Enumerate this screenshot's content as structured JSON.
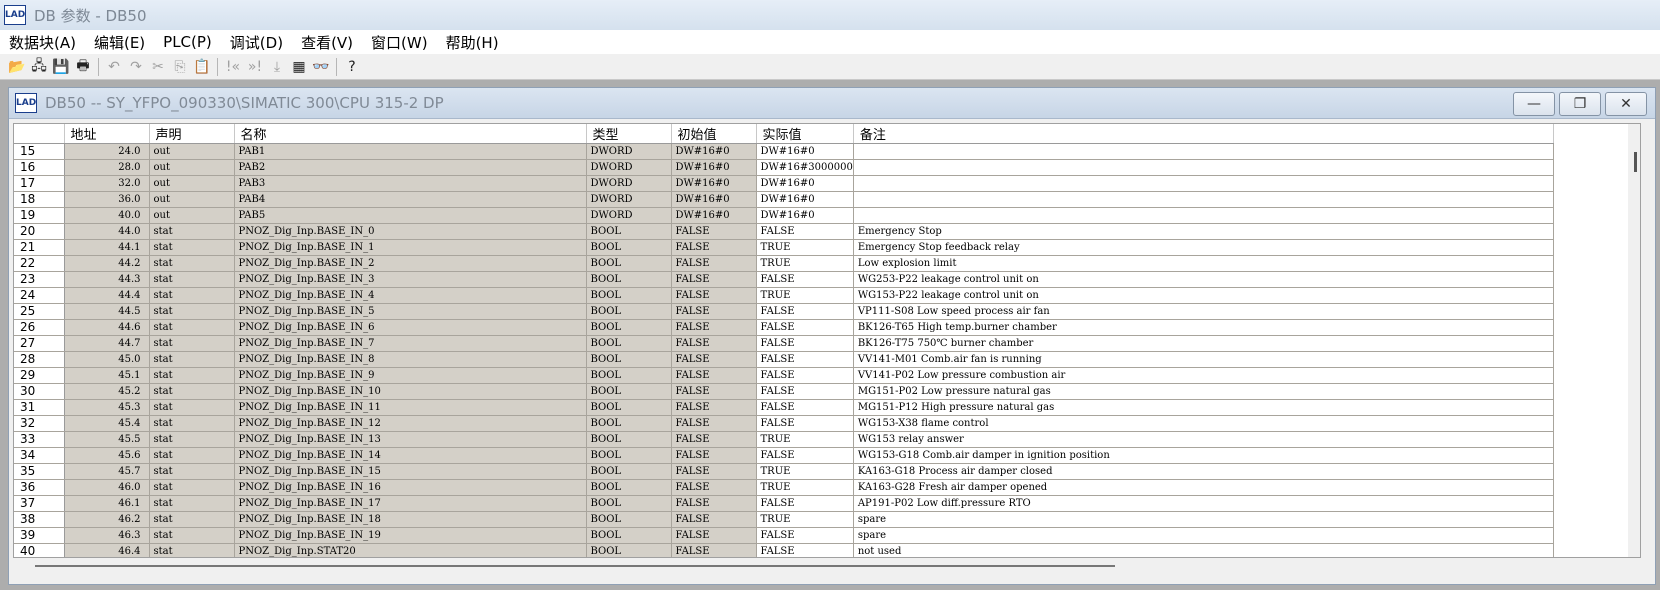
{
  "app": {
    "title": "DB 参数 - DB50",
    "icon_label": "LAD"
  },
  "menu": [
    "数据块(A)",
    "编辑(E)",
    "PLC(P)",
    "调试(D)",
    "查看(V)",
    "窗口(W)",
    "帮助(H)"
  ],
  "toolbar": [
    {
      "name": "open-icon",
      "glyph": "📂",
      "enabled": true
    },
    {
      "name": "network-icon",
      "glyph": "🖧",
      "enabled": true
    },
    {
      "name": "save-icon",
      "glyph": "💾",
      "enabled": true
    },
    {
      "name": "print-icon",
      "glyph": "🖶",
      "enabled": true
    },
    {
      "sep": true
    },
    {
      "name": "undo-icon",
      "glyph": "↶",
      "enabled": false
    },
    {
      "name": "redo-icon",
      "glyph": "↷",
      "enabled": false
    },
    {
      "name": "cut-icon",
      "glyph": "✂",
      "enabled": false
    },
    {
      "name": "copy-icon",
      "glyph": "⎘",
      "enabled": false
    },
    {
      "name": "paste-icon",
      "glyph": "📋",
      "enabled": false
    },
    {
      "sep": true
    },
    {
      "name": "prev-icon",
      "glyph": "!«",
      "enabled": false
    },
    {
      "name": "next-icon",
      "glyph": "»!",
      "enabled": false
    },
    {
      "name": "download-icon",
      "glyph": "⤓",
      "enabled": false
    },
    {
      "name": "hardware-icon",
      "glyph": "▦",
      "enabled": true
    },
    {
      "name": "monitor-icon",
      "glyph": "👓",
      "enabled": true
    },
    {
      "sep": true
    },
    {
      "name": "help-icon",
      "glyph": "?",
      "enabled": true
    }
  ],
  "child": {
    "title": "DB50 -- SY_YFPO_090330\\SIMATIC 300\\CPU 315-2 DP"
  },
  "table": {
    "headers": [
      "地址",
      "声明",
      "名称",
      "类型",
      "初始值",
      "实际值",
      "备注"
    ],
    "rows": [
      [
        "15",
        "24.0",
        "out",
        "PAB1",
        "DWORD",
        "DW#16#0",
        "DW#16#0",
        ""
      ],
      [
        "16",
        "28.0",
        "out",
        "PAB2",
        "DWORD",
        "DW#16#0",
        "DW#16#3000000",
        ""
      ],
      [
        "17",
        "32.0",
        "out",
        "PAB3",
        "DWORD",
        "DW#16#0",
        "DW#16#0",
        ""
      ],
      [
        "18",
        "36.0",
        "out",
        "PAB4",
        "DWORD",
        "DW#16#0",
        "DW#16#0",
        ""
      ],
      [
        "19",
        "40.0",
        "out",
        "PAB5",
        "DWORD",
        "DW#16#0",
        "DW#16#0",
        ""
      ],
      [
        "20",
        "44.0",
        "stat",
        "PNOZ_Dig_Inp.BASE_IN_0",
        "BOOL",
        "FALSE",
        "FALSE",
        "Emergency Stop"
      ],
      [
        "21",
        "44.1",
        "stat",
        "PNOZ_Dig_Inp.BASE_IN_1",
        "BOOL",
        "FALSE",
        "TRUE",
        "Emergency Stop feedback relay"
      ],
      [
        "22",
        "44.2",
        "stat",
        "PNOZ_Dig_Inp.BASE_IN_2",
        "BOOL",
        "FALSE",
        "TRUE",
        "Low explosion limit"
      ],
      [
        "23",
        "44.3",
        "stat",
        "PNOZ_Dig_Inp.BASE_IN_3",
        "BOOL",
        "FALSE",
        "FALSE",
        "WG253-P22 leakage control unit on"
      ],
      [
        "24",
        "44.4",
        "stat",
        "PNOZ_Dig_Inp.BASE_IN_4",
        "BOOL",
        "FALSE",
        "TRUE",
        "WG153-P22 leakage control unit on"
      ],
      [
        "25",
        "44.5",
        "stat",
        "PNOZ_Dig_Inp.BASE_IN_5",
        "BOOL",
        "FALSE",
        "FALSE",
        "VP111-S08 Low speed process air fan"
      ],
      [
        "26",
        "44.6",
        "stat",
        "PNOZ_Dig_Inp.BASE_IN_6",
        "BOOL",
        "FALSE",
        "FALSE",
        "BK126-T65 High temp.burner chamber"
      ],
      [
        "27",
        "44.7",
        "stat",
        "PNOZ_Dig_Inp.BASE_IN_7",
        "BOOL",
        "FALSE",
        "FALSE",
        "BK126-T75 750℃ burner chamber"
      ],
      [
        "28",
        "45.0",
        "stat",
        "PNOZ_Dig_Inp.BASE_IN_8",
        "BOOL",
        "FALSE",
        "FALSE",
        "VV141-M01 Comb.air fan is running"
      ],
      [
        "29",
        "45.1",
        "stat",
        "PNOZ_Dig_Inp.BASE_IN_9",
        "BOOL",
        "FALSE",
        "FALSE",
        "VV141-P02 Low pressure combustion air"
      ],
      [
        "30",
        "45.2",
        "stat",
        "PNOZ_Dig_Inp.BASE_IN_10",
        "BOOL",
        "FALSE",
        "FALSE",
        "MG151-P02 Low pressure natural gas"
      ],
      [
        "31",
        "45.3",
        "stat",
        "PNOZ_Dig_Inp.BASE_IN_11",
        "BOOL",
        "FALSE",
        "FALSE",
        "MG151-P12 High pressure natural gas"
      ],
      [
        "32",
        "45.4",
        "stat",
        "PNOZ_Dig_Inp.BASE_IN_12",
        "BOOL",
        "FALSE",
        "FALSE",
        "WG153-X38 flame control"
      ],
      [
        "33",
        "45.5",
        "stat",
        "PNOZ_Dig_Inp.BASE_IN_13",
        "BOOL",
        "FALSE",
        "TRUE",
        "WG153 relay answer"
      ],
      [
        "34",
        "45.6",
        "stat",
        "PNOZ_Dig_Inp.BASE_IN_14",
        "BOOL",
        "FALSE",
        "FALSE",
        "WG153-G18 Comb.air damper in ignition position"
      ],
      [
        "35",
        "45.7",
        "stat",
        "PNOZ_Dig_Inp.BASE_IN_15",
        "BOOL",
        "FALSE",
        "TRUE",
        "KA163-G18 Process air damper closed"
      ],
      [
        "36",
        "46.0",
        "stat",
        "PNOZ_Dig_Inp.BASE_IN_16",
        "BOOL",
        "FALSE",
        "TRUE",
        "KA163-G28 Fresh air damper opened"
      ],
      [
        "37",
        "46.1",
        "stat",
        "PNOZ_Dig_Inp.BASE_IN_17",
        "BOOL",
        "FALSE",
        "FALSE",
        "AP191-P02 Low diff.pressure RTO"
      ],
      [
        "38",
        "46.2",
        "stat",
        "PNOZ_Dig_Inp.BASE_IN_18",
        "BOOL",
        "FALSE",
        "TRUE",
        "spare"
      ],
      [
        "39",
        "46.3",
        "stat",
        "PNOZ_Dig_Inp.BASE_IN_19",
        "BOOL",
        "FALSE",
        "FALSE",
        "spare"
      ],
      [
        "40",
        "46.4",
        "stat",
        "PNOZ_Dig_Inp.STAT20",
        "BOOL",
        "FALSE",
        "FALSE",
        "not used"
      ]
    ]
  }
}
